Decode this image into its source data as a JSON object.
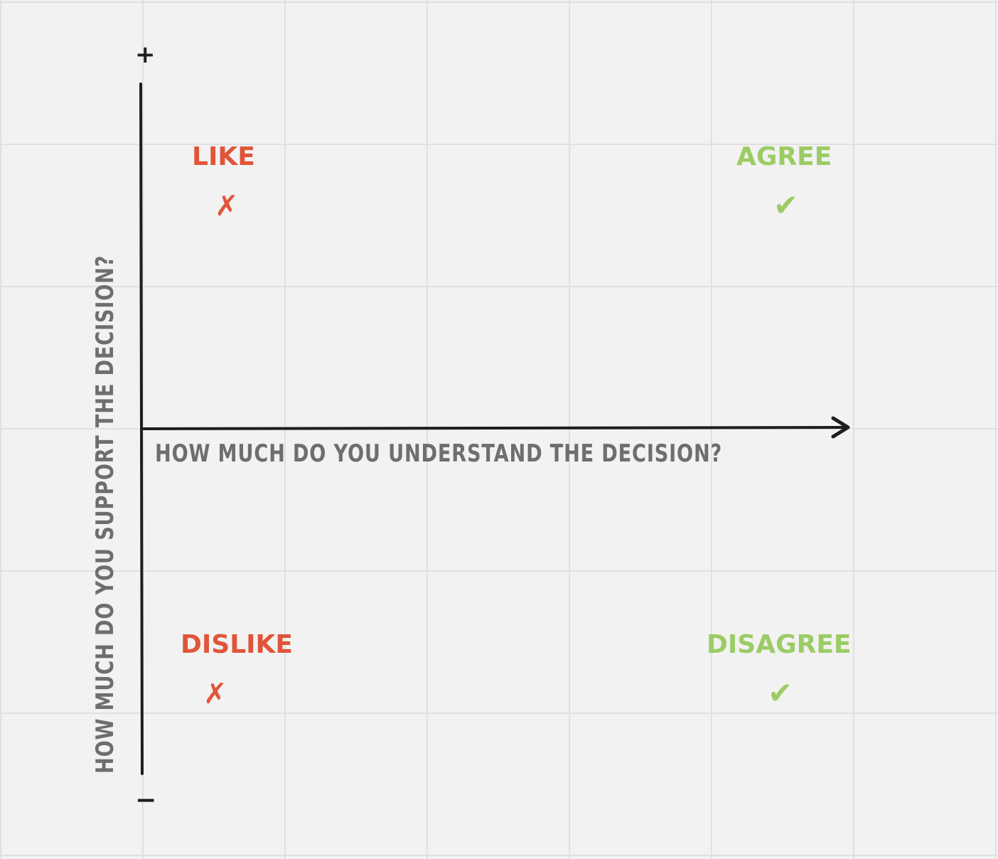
{
  "axes": {
    "x_title": "How much do you understand the decision?",
    "y_title": "How much do you support the decision?",
    "y_top_sign": "+",
    "y_bottom_sign": "−"
  },
  "quadrants": {
    "top_left": {
      "label": "Like",
      "mark": "✗"
    },
    "top_right": {
      "label": "Agree",
      "mark": "✔"
    },
    "bottom_left": {
      "label": "Dislike",
      "mark": "✗"
    },
    "bottom_right": {
      "label": "Disagree",
      "mark": "✔"
    }
  },
  "colors": {
    "red": "#e0553a",
    "green": "#9ccc65",
    "axis": "#1e1e1e",
    "axis_title": "#6e6e6e",
    "background": "#f2f2f2",
    "grid": "#e0e0e0"
  }
}
